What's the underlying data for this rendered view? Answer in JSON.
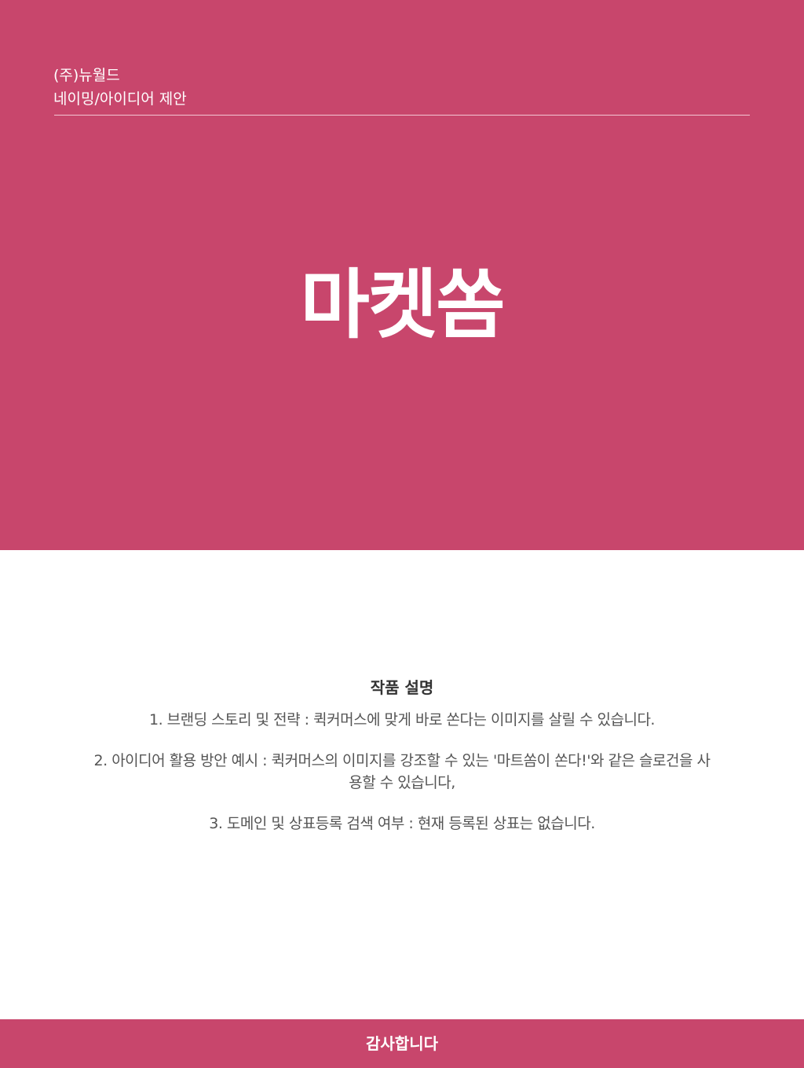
{
  "colors": {
    "accent": "#c8466c",
    "background": "#ffffff",
    "text": "#555555",
    "heading": "#333333"
  },
  "header": {
    "company": "(주)뉴월드",
    "category": "네이밍/아이디어 제안"
  },
  "hero": {
    "brand_name": "마켓쏨"
  },
  "description": {
    "title": "작품 설명",
    "items": [
      "1. 브랜딩 스토리 및 전략 : 퀵커머스에 맞게 바로 쏜다는 이미지를 살릴 수 있습니다.",
      "2. 아이디어 활용 방안 예시 : 퀵커머스의 이미지를 강조할 수 있는 '마트쏨이 쏜다!'와 같은 슬로건을 사용할 수 있습니다,",
      "3. 도메인 및 상표등록 검색 여부 : 현재 등록된 상표는 없습니다."
    ]
  },
  "footer": {
    "text": "감사합니다"
  }
}
